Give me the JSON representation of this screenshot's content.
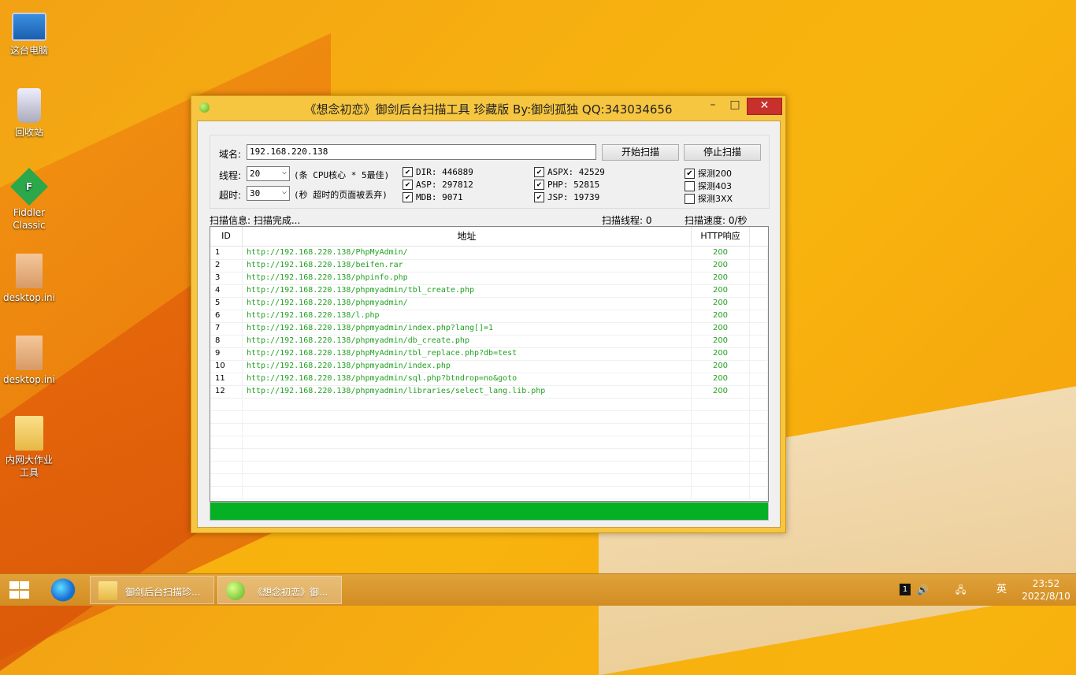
{
  "desktop": {
    "icons": [
      {
        "label": "这台电脑"
      },
      {
        "label": "回收站"
      },
      {
        "label": "Fiddler Classic"
      },
      {
        "label": "desktop.ini"
      },
      {
        "label": "desktop.ini"
      },
      {
        "label": "内网大作业工具"
      }
    ]
  },
  "window": {
    "title": "《想念初恋》御剑后台扫描工具 珍藏版 By:御剑孤独 QQ:343034656",
    "min_glyph": "–",
    "max_glyph": "□",
    "close_glyph": "✕"
  },
  "form": {
    "domain_label": "域名:",
    "domain_value": "192.168.220.138",
    "start_button": "开始扫描",
    "stop_button": "停止扫描",
    "threads_label": "线程:",
    "threads_value": "20",
    "threads_hint": "(条 CPU核心 * 5最佳)",
    "timeout_label": "超时:",
    "timeout_value": "30",
    "timeout_hint": "(秒 超时的页面被丢弃)",
    "dicts": [
      {
        "label": "DIR: 446889",
        "checked": true
      },
      {
        "label": "ASP: 297812",
        "checked": true
      },
      {
        "label": "MDB: 9071",
        "checked": true
      },
      {
        "label": "ASPX: 42529",
        "checked": true
      },
      {
        "label": "PHP: 52815",
        "checked": true
      },
      {
        "label": "JSP: 19739",
        "checked": true
      }
    ],
    "probes": [
      {
        "label": "探测200",
        "checked": true
      },
      {
        "label": "探测403",
        "checked": false
      },
      {
        "label": "探测3XX",
        "checked": false
      }
    ],
    "check_glyph": "✔"
  },
  "status": {
    "info": "扫描信息: 扫描完成...",
    "threads": "扫描线程: 0",
    "speed": "扫描速度: 0/秒"
  },
  "results": {
    "columns": [
      "ID",
      "地址",
      "HTTP响应"
    ],
    "rows": [
      {
        "id": "1",
        "url": "http://192.168.220.138/PhpMyAdmin/",
        "code": "200"
      },
      {
        "id": "2",
        "url": "http://192.168.220.138/beifen.rar",
        "code": "200"
      },
      {
        "id": "3",
        "url": "http://192.168.220.138/phpinfo.php",
        "code": "200"
      },
      {
        "id": "4",
        "url": "http://192.168.220.138/phpmyadmin/tbl_create.php",
        "code": "200"
      },
      {
        "id": "5",
        "url": "http://192.168.220.138/phpmyadmin/",
        "code": "200"
      },
      {
        "id": "6",
        "url": "http://192.168.220.138/l.php",
        "code": "200"
      },
      {
        "id": "7",
        "url": "http://192.168.220.138/phpmyadmin/index.php?lang[]=1",
        "code": "200"
      },
      {
        "id": "8",
        "url": "http://192.168.220.138/phpmyadmin/db_create.php",
        "code": "200"
      },
      {
        "id": "9",
        "url": "http://192.168.220.138/phpMyAdmin/tbl_replace.php?db=test",
        "code": "200"
      },
      {
        "id": "10",
        "url": "http://192.168.220.138/phpmyadmin/index.php",
        "code": "200"
      },
      {
        "id": "11",
        "url": "http://192.168.220.138/phpmyadmin/sql.php?btndrop=no&goto",
        "code": "200"
      },
      {
        "id": "12",
        "url": "http://192.168.220.138/phpmyadmin/libraries/select_lang.lib.php",
        "code": "200"
      }
    ],
    "empty_rows": 8
  },
  "progress": {
    "fraction": 1.0,
    "color": "#06b025"
  },
  "taskbar": {
    "tasks": [
      {
        "label": "御剑后台扫描珍..."
      },
      {
        "label": "《想念初恋》御..."
      }
    ],
    "tray_ime": "英",
    "clock_time": "23:52",
    "clock_date": "2022/8/10"
  },
  "colors": {
    "accent_green": "#22a022",
    "close_red": "#c7302b"
  }
}
